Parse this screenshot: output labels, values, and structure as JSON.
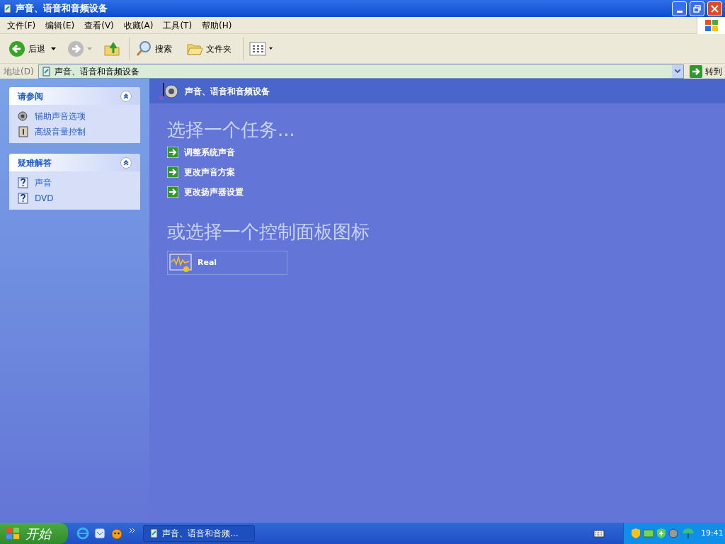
{
  "window": {
    "title": "声音、语音和音频设备"
  },
  "menu": [
    "文件(F)",
    "编辑(E)",
    "查看(V)",
    "收藏(A)",
    "工具(T)",
    "帮助(H)"
  ],
  "toolbar": {
    "back": "后退",
    "search": "搜索",
    "folders": "文件夹"
  },
  "address": {
    "label": "地址(D)",
    "value": "声音、语音和音频设备",
    "go": "转到"
  },
  "sidebar": [
    {
      "title": "请参阅",
      "expanded": true,
      "items": [
        {
          "kind": "speaker",
          "label": "辅助声音选项"
        },
        {
          "kind": "volume",
          "label": "高级音量控制"
        }
      ]
    },
    {
      "title": "疑难解答",
      "expanded": true,
      "items": [
        {
          "kind": "help",
          "label": "声音"
        },
        {
          "kind": "help",
          "label": "DVD"
        }
      ]
    }
  ],
  "header": "声音、语音和音频设备",
  "tasks_title": "选择一个任务...",
  "tasks": [
    "调整系统声音",
    "更改声音方案",
    "更改扬声器设置"
  ],
  "icons_title": "或选择一个控制面板图标",
  "icons": [
    "Real"
  ],
  "taskbar": {
    "start": "开始",
    "window": "声音、语音和音频...",
    "clock": "19:41"
  }
}
